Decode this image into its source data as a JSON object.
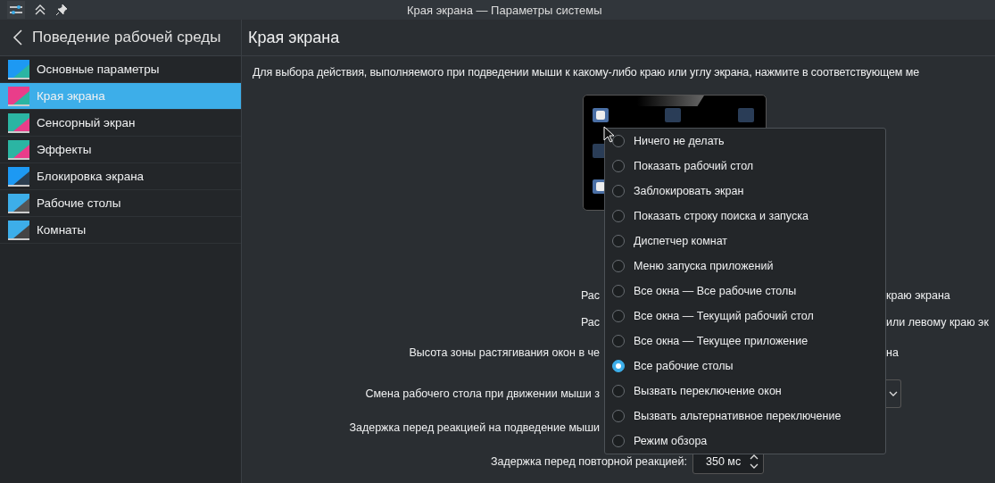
{
  "window": {
    "title": "Края экрана — Параметры системы"
  },
  "sidebar": {
    "title": "Поведение рабочей среды",
    "items": [
      {
        "label": "Основные параметры",
        "selected": false
      },
      {
        "label": "Края экрана",
        "selected": true
      },
      {
        "label": "Сенсорный экран",
        "selected": false
      },
      {
        "label": "Эффекты",
        "selected": false
      },
      {
        "label": "Блокировка экрана",
        "selected": false
      },
      {
        "label": "Рабочие столы",
        "selected": false
      },
      {
        "label": "Комнаты",
        "selected": false
      }
    ]
  },
  "page": {
    "title": "Края экрана",
    "description": "Для выбора действия, выполняемого при подведении мыши к какому-либо краю или углу экрана, нажмите в соответствующем ме",
    "rows": [
      {
        "kind": "text",
        "left": "Рас",
        "right": "краю экрана"
      },
      {
        "kind": "text",
        "left": "Рас",
        "right": "или левому краю эк"
      },
      {
        "kind": "text",
        "left": "Высота зоны растягивания окон в че",
        "right": "на"
      },
      {
        "kind": "dropdown",
        "left": "Смена рабочего стола при движении мыши з"
      },
      {
        "kind": "text",
        "left": "Задержка перед реакцией на подведение мыши"
      },
      {
        "kind": "spin",
        "left": "Задержка перед повторной реакцией:",
        "value": "350 мс"
      }
    ]
  },
  "menu": {
    "items": [
      {
        "label": "Ничего не делать",
        "selected": false
      },
      {
        "label": "Показать рабочий стол",
        "selected": false
      },
      {
        "label": "Заблокировать экран",
        "selected": false
      },
      {
        "label": "Показать строку поиска и запуска",
        "selected": false
      },
      {
        "label": "Диспетчер комнат",
        "selected": false
      },
      {
        "label": "Меню запуска приложений",
        "selected": false
      },
      {
        "label": "Все окна — Все рабочие столы",
        "selected": false
      },
      {
        "label": "Все окна — Текущий рабочий стол",
        "selected": false
      },
      {
        "label": "Все окна — Текущее приложение",
        "selected": false
      },
      {
        "label": "Все рабочие столы",
        "selected": true
      },
      {
        "label": "Вызвать переключение окон",
        "selected": false
      },
      {
        "label": "Вызвать альтернативное переключение",
        "selected": false
      },
      {
        "label": "Режим обзора",
        "selected": false
      }
    ]
  }
}
